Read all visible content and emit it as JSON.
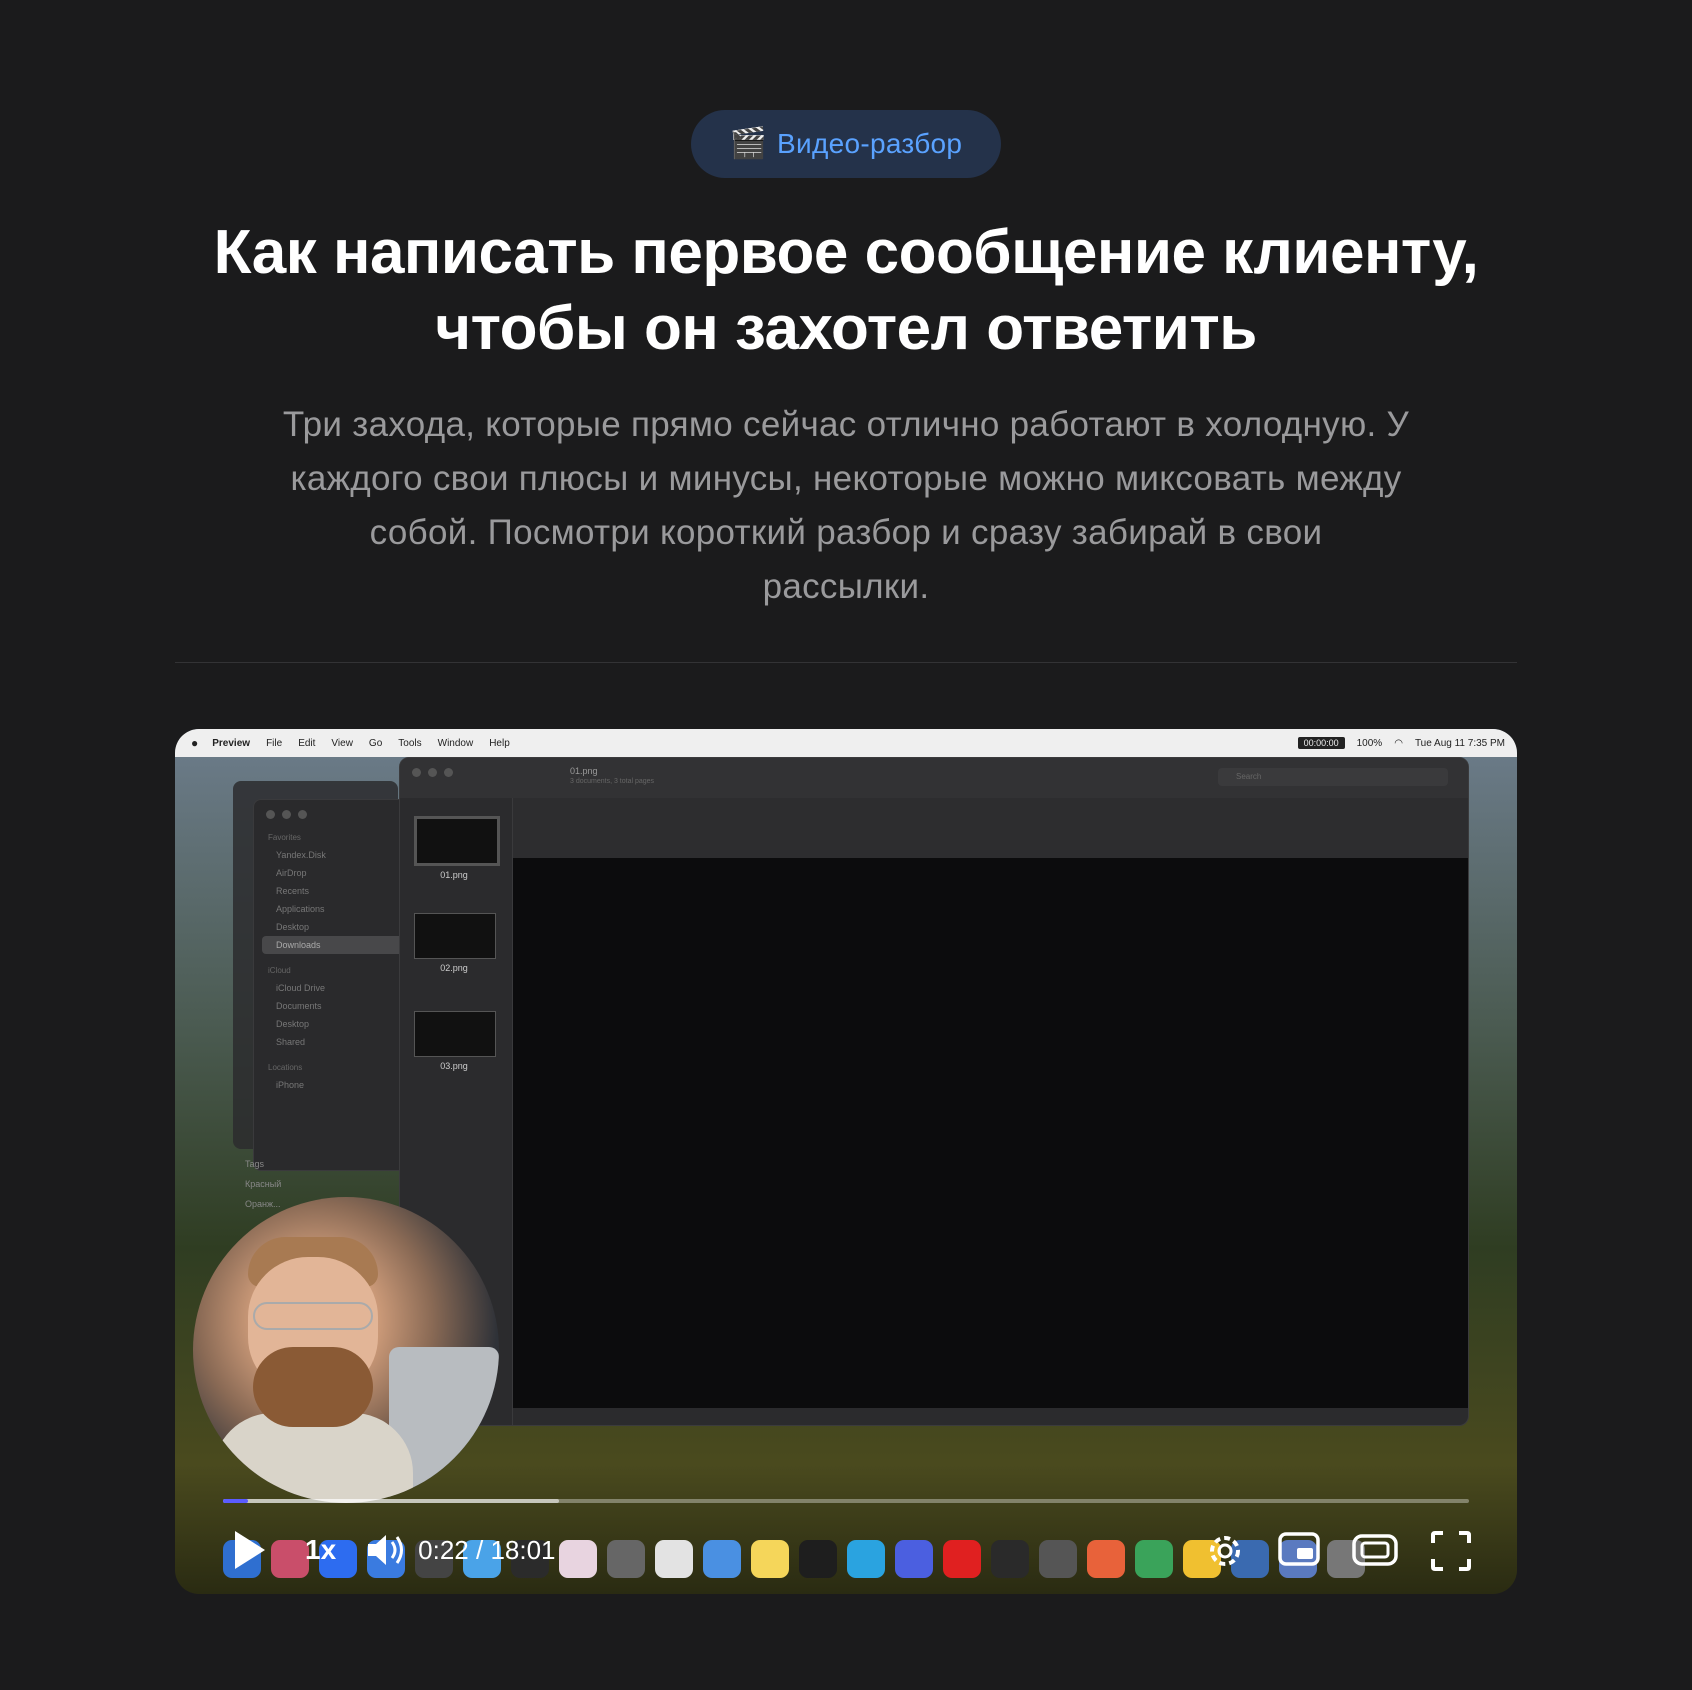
{
  "badge": {
    "icon": "clapperboard-icon",
    "label": "Видео-разбор"
  },
  "title": {
    "line1": "Как написать первое сообщение клиенту,",
    "line2": "чтобы он захотел ответить"
  },
  "subtitle": {
    "line1": "Три захода, которые прямо сейчас отлично работают в холодную. У",
    "line2": "каждого свои плюсы и минусы, некоторые можно миксовать между",
    "line3": "собой. Посмотри короткий разбор и сразу забирай в свои",
    "line4": "рассылки."
  },
  "video": {
    "menubar": {
      "app": "Preview",
      "items": [
        "File",
        "Edit",
        "View",
        "Go",
        "Tools",
        "Window",
        "Help"
      ],
      "recording_time": "00:00:00",
      "battery": "100%",
      "datetime": "Tue Aug 11  7:35 PM"
    },
    "finder": {
      "favorites_header": "Favorites",
      "favorites": [
        "Yandex.Disk",
        "AirDrop",
        "Recents",
        "Applications",
        "Desktop",
        "Downloads"
      ],
      "icloud_header": "iCloud",
      "icloud": [
        "iCloud Drive",
        "Documents",
        "Desktop",
        "Shared"
      ],
      "locations_header": "Locations",
      "locations": [
        "iPhone"
      ],
      "tags_header": "Tags",
      "tags": [
        "Красный",
        "Оранж..."
      ]
    },
    "preview": {
      "filename": "01.png",
      "subtitle": "3 documents, 3 total pages",
      "search_placeholder": "Search",
      "thumbnails": [
        "01.png",
        "02.png",
        "03.png"
      ]
    },
    "controls": {
      "speed": "1x",
      "current_time": "0:22",
      "separator": " / ",
      "duration": "18:01",
      "progress": 0.02,
      "buffered": 0.27
    },
    "colors": {
      "accent": "#5b5cff",
      "badge_text": "#5aa2ff",
      "badge_bg": "#24324a"
    }
  }
}
